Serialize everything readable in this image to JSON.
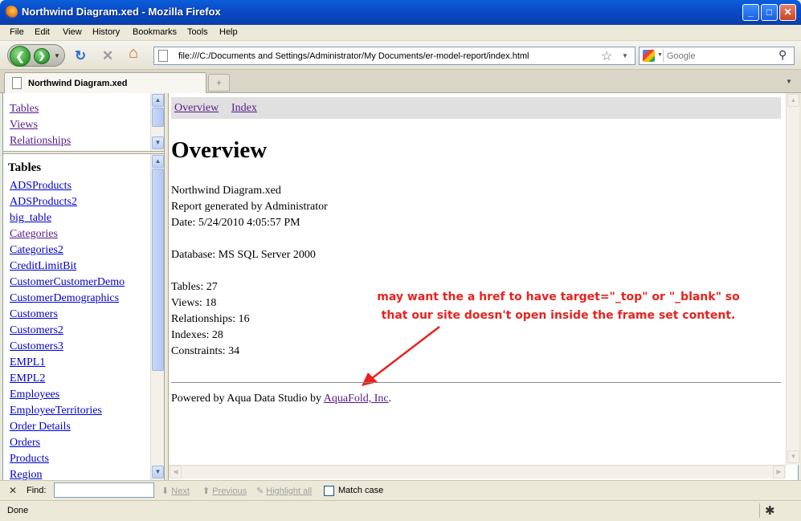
{
  "window": {
    "title": "Northwind Diagram.xed - Mozilla Firefox",
    "minimize": "_",
    "maximize": "□",
    "close": "✕"
  },
  "menu": [
    "File",
    "Edit",
    "View",
    "History",
    "Bookmarks",
    "Tools",
    "Help"
  ],
  "toolbar": {
    "back_glyph": "❮",
    "forward_glyph": "❯",
    "reload_glyph": "↻",
    "stop_glyph": "✕",
    "home_glyph": "⌂",
    "url": "file:///C:/Documents and Settings/Administrator/My Documents/er-model-report/index.html",
    "search_placeholder": "Google"
  },
  "tabs": {
    "active_label": "Northwind Diagram.xed",
    "new_tab_glyph": "+"
  },
  "nav_frame": {
    "links": [
      "Tables",
      "Views",
      "Relationships"
    ]
  },
  "tables_frame": {
    "heading": "Tables",
    "items": [
      "ADSProducts",
      "ADSProducts2",
      "big_table",
      "Categories",
      "Categories2",
      "CreditLimitBit",
      "CustomerCustomerDemo",
      "CustomerDemographics",
      "Customers",
      "Customers2",
      "Customers3",
      "EMPL1",
      "EMPL2",
      "Employees",
      "EmployeeTerritories",
      "Order Details",
      "Orders",
      "Products",
      "Region"
    ]
  },
  "main_frame": {
    "nav": [
      "Overview",
      "Index"
    ],
    "heading": "Overview",
    "info_lines": [
      "Northwind Diagram.xed",
      "Report generated by Administrator",
      "Date: 5/24/2010 4:05:57 PM",
      "",
      "Database: MS SQL Server 2000",
      "",
      "Tables: 27",
      "Views: 18",
      "Relationships: 16",
      "Indexes: 28",
      "Constraints: 34"
    ],
    "powered_prefix": "Powered by Aqua Data Studio by ",
    "powered_link": "AquaFold, Inc",
    "powered_suffix": "."
  },
  "annotation": {
    "line1": "may want the a href to have target=\"_top\"  or \"_blank\" so",
    "line2": "that our site doesn't open inside the frame set content.",
    "color": "#e8231f"
  },
  "findbar": {
    "label": "Find:",
    "next": "Next",
    "previous": "Previous",
    "highlight": "Highlight all",
    "match_case": "Match case"
  },
  "status": {
    "text": "Done"
  }
}
